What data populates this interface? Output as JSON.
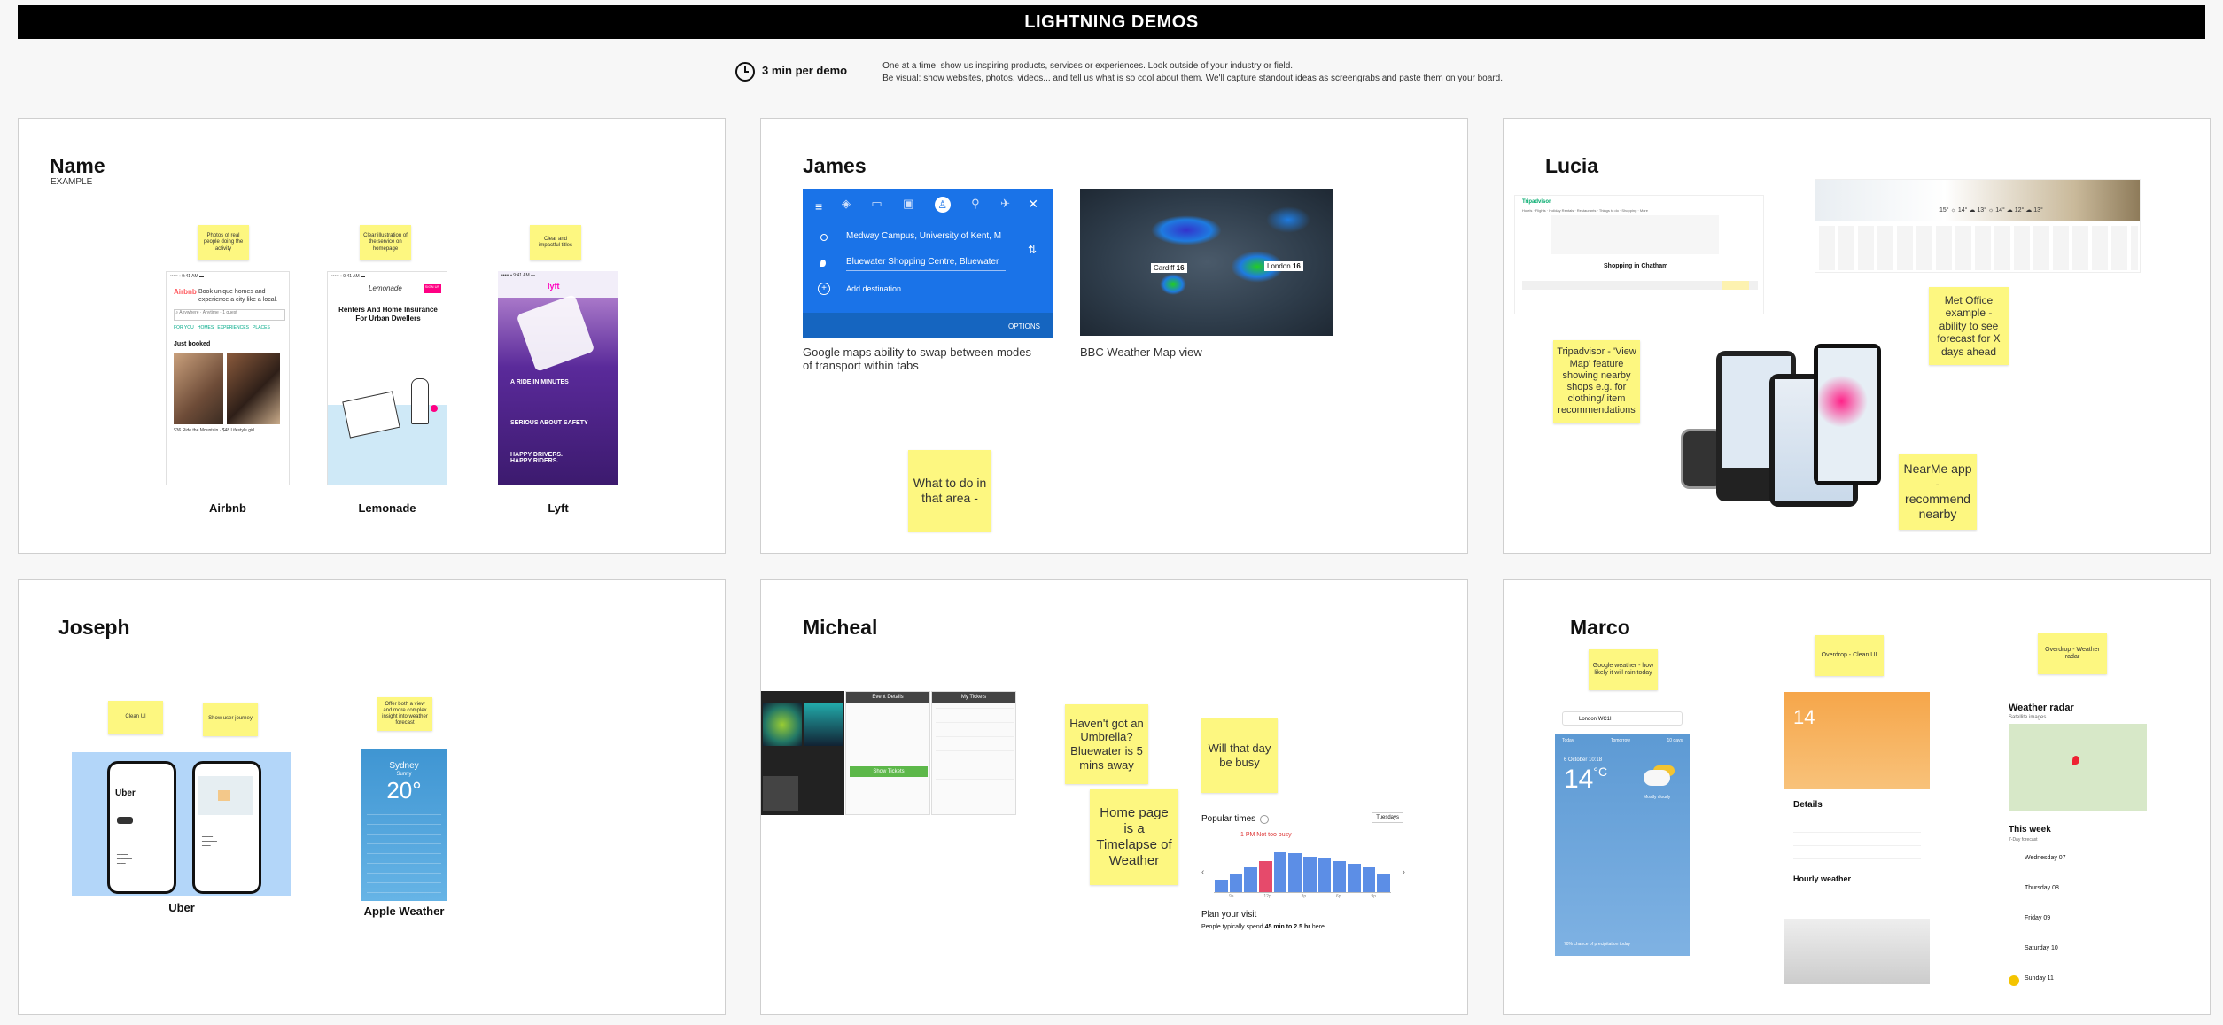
{
  "header": {
    "title": "LIGHTNING DEMOS"
  },
  "subheader": {
    "time_label": "3 min per demo",
    "line1": "One at a time, show us inspiring products, services or experiences. Look outside of your industry or field.",
    "line2": "Be visual: show websites, photos, videos... and tell us what is so cool about them. We'll capture standout ideas as screengrabs and paste them on your board."
  },
  "panels": {
    "name": {
      "title": "Name",
      "subtitle": "EXAMPLE",
      "stickies": [
        "Photos of real people doing the activity",
        "Clear illustration of the service on homepage",
        "Clear and impactful titles"
      ],
      "captions": [
        "Airbnb",
        "Lemonade",
        "Lyft"
      ],
      "airbnb": {
        "brand": "Airbnb",
        "tagline": "Book unique homes and experience a city like a local.",
        "just_booked": "Just booked"
      },
      "lemonade": {
        "logo": "Lemonade",
        "headline": "Renters And Home Insurance For Urban Dwellers"
      },
      "lyft": {
        "logo": "lyft",
        "h1": "A RIDE IN MINUTES",
        "h2": "SERIOUS ABOUT SAFETY",
        "h3": "HAPPY DRIVERS. HAPPY RIDERS."
      }
    },
    "james": {
      "title": "James",
      "maps": {
        "from": "Medway Campus, University of Kent, M",
        "to": "Bluewater Shopping Centre, Bluewater",
        "add": "Add destination",
        "options": "OPTIONS"
      },
      "weather_map": {
        "city1": "Cardiff",
        "temp1": "16",
        "city2": "London",
        "temp2": "16"
      },
      "caption1": "Google maps ability to swap between modes of transport within tabs",
      "caption2": "BBC Weather Map view",
      "sticky": "What to do in that area -"
    },
    "lucia": {
      "title": "Lucia",
      "tripadvisor": {
        "logo": "Tripadvisor",
        "heading": "Shopping in Chatham"
      },
      "sticky1": "Tripadvisor - 'View Map' feature showing nearby shops e.g. for clothing/ item recommendations",
      "sticky2": "Met Office example - ability to see forecast for X days ahead",
      "sticky3": "NearMe app - recommend nearby"
    },
    "joseph": {
      "title": "Joseph",
      "stickies": [
        "Clean UI",
        "Show user journey",
        "Offer both a view and more complex insight into weather forecast"
      ],
      "captions": [
        "Uber",
        "Apple Weather"
      ],
      "uber": {
        "logo": "Uber"
      },
      "apple_weather": {
        "city": "Sydney",
        "condition": "Sunny",
        "temp": "20°"
      }
    },
    "micheal": {
      "title": "Micheal",
      "stickies": [
        "Haven't got an Umbrella? Bluewater is 5 mins away",
        "Will that day be busy",
        "Home page is a Timelapse of Weather"
      ],
      "event": {
        "title": "Event Details",
        "button": "Show Tickets",
        "tickets": "My Tickets"
      },
      "popular": {
        "title": "Popular times",
        "day": "Tuesdays",
        "busy": "1 PM Not too busy",
        "plan": "Plan your visit",
        "spend_prefix": "People typically spend ",
        "spend_value": "45 min to 2.5 hr",
        "spend_suffix": " here",
        "bars": [
          0.25,
          0.35,
          0.5,
          0.62,
          0.8,
          0.78,
          0.72,
          0.7,
          0.62,
          0.58,
          0.5,
          0.35
        ],
        "highlight_index": 3,
        "hours": [
          "9a",
          "12p",
          "3p",
          "6p",
          "9p"
        ]
      }
    },
    "marco": {
      "title": "Marco",
      "stickies": [
        "Google weather - how likely it will rain today",
        "Overdrop - Clean UI",
        "Overdrop - Weather radar"
      ],
      "google_weather": {
        "search": "London WC1H",
        "tab1": "Today",
        "tab2": "Tomorrow",
        "tab3": "10 days",
        "date": "6 October 10:18",
        "temp": "14",
        "unit": "°C",
        "condition": "Mostly cloudy",
        "footer": "70% chance of precipitation today"
      },
      "overdrop": {
        "temp": "14",
        "details": "Details",
        "hourly": "Hourly weather"
      },
      "radar": {
        "title": "Weather radar",
        "subtitle": "Satellite images",
        "week": "This week",
        "week_sub": "7-Day forecast",
        "days": [
          "Wednesday 07",
          "Thursday 08",
          "Friday 09",
          "Saturday 10",
          "Sunday 11"
        ]
      }
    }
  }
}
